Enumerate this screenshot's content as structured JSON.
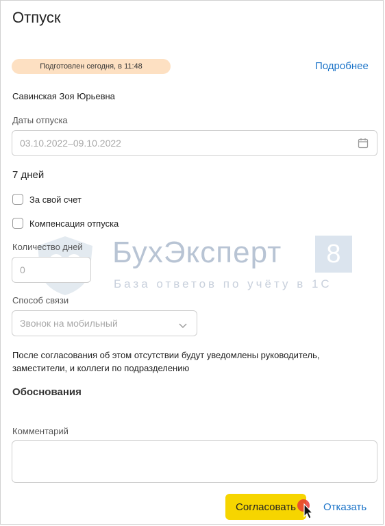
{
  "header": {
    "title": "Отпуск"
  },
  "status": {
    "badge": "Подготовлен сегодня, в 11:48",
    "more_link": "Подробнее"
  },
  "employee": {
    "name": "Савинская Зоя Юрьевна"
  },
  "dates": {
    "label": "Даты отпуска",
    "value": "03.10.2022–09.10.2022",
    "icon": "calendar-icon"
  },
  "duration": {
    "text": "7 дней"
  },
  "options": [
    {
      "label": "За свой счет",
      "checked": false
    },
    {
      "label": "Компенсация отпуска",
      "checked": false
    }
  ],
  "days_count": {
    "label": "Количество дней",
    "value": "0"
  },
  "contact": {
    "label": "Способ связи",
    "value": "Звонок на мобильный"
  },
  "notice": "После согласования об этом отсутствии будут уведомлены руководитель, заместители, и коллеги по подразделению",
  "justification": {
    "title": "Обоснования",
    "comment_label": "Комментарий",
    "comment_value": ""
  },
  "actions": {
    "approve": "Согласовать",
    "reject": "Отказать"
  },
  "watermark": {
    "brand": "БухЭксперт",
    "number": "8",
    "tagline": "База ответов по учёту в 1С"
  },
  "colors": {
    "badge_bg": "#fde0c2",
    "link": "#1a73c8",
    "approve_bg": "#f6d500"
  }
}
